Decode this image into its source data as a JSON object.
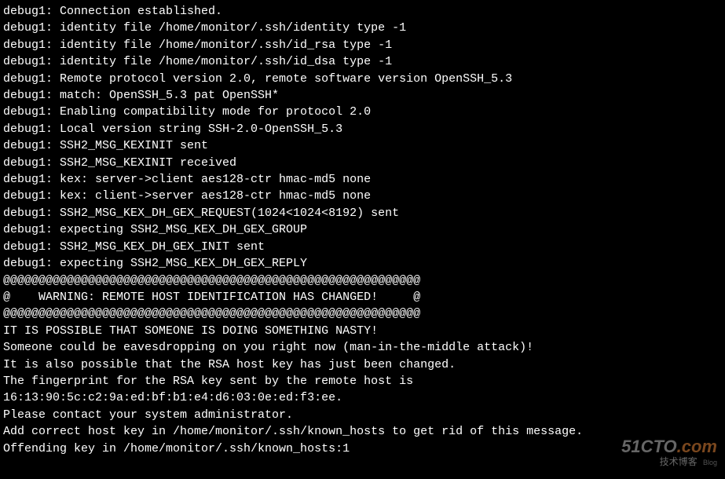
{
  "terminal": {
    "lines": [
      "debug1: Connection established.",
      "debug1: identity file /home/monitor/.ssh/identity type -1",
      "debug1: identity file /home/monitor/.ssh/id_rsa type -1",
      "debug1: identity file /home/monitor/.ssh/id_dsa type -1",
      "debug1: Remote protocol version 2.0, remote software version OpenSSH_5.3",
      "debug1: match: OpenSSH_5.3 pat OpenSSH*",
      "debug1: Enabling compatibility mode for protocol 2.0",
      "debug1: Local version string SSH-2.0-OpenSSH_5.3",
      "debug1: SSH2_MSG_KEXINIT sent",
      "debug1: SSH2_MSG_KEXINIT received",
      "debug1: kex: server->client aes128-ctr hmac-md5 none",
      "debug1: kex: client->server aes128-ctr hmac-md5 none",
      "debug1: SSH2_MSG_KEX_DH_GEX_REQUEST(1024<1024<8192) sent",
      "debug1: expecting SSH2_MSG_KEX_DH_GEX_GROUP",
      "debug1: SSH2_MSG_KEX_DH_GEX_INIT sent",
      "debug1: expecting SSH2_MSG_KEX_DH_GEX_REPLY",
      "@@@@@@@@@@@@@@@@@@@@@@@@@@@@@@@@@@@@@@@@@@@@@@@@@@@@@@@@@@@",
      "@    WARNING: REMOTE HOST IDENTIFICATION HAS CHANGED!     @",
      "@@@@@@@@@@@@@@@@@@@@@@@@@@@@@@@@@@@@@@@@@@@@@@@@@@@@@@@@@@@",
      "IT IS POSSIBLE THAT SOMEONE IS DOING SOMETHING NASTY!",
      "Someone could be eavesdropping on you right now (man-in-the-middle attack)!",
      "It is also possible that the RSA host key has just been changed.",
      "The fingerprint for the RSA key sent by the remote host is",
      "16:13:90:5c:c2:9a:ed:bf:b1:e4:d6:03:0e:ed:f3:ee.",
      "Please contact your system administrator.",
      "Add correct host key in /home/monitor/.ssh/known_hosts to get rid of this message.",
      "Offending key in /home/monitor/.ssh/known_hosts:1"
    ]
  },
  "watermark": {
    "brand_prefix": "51CTO",
    "brand_suffix": ".com",
    "subtitle": "技术博客",
    "tag": "Blog"
  }
}
